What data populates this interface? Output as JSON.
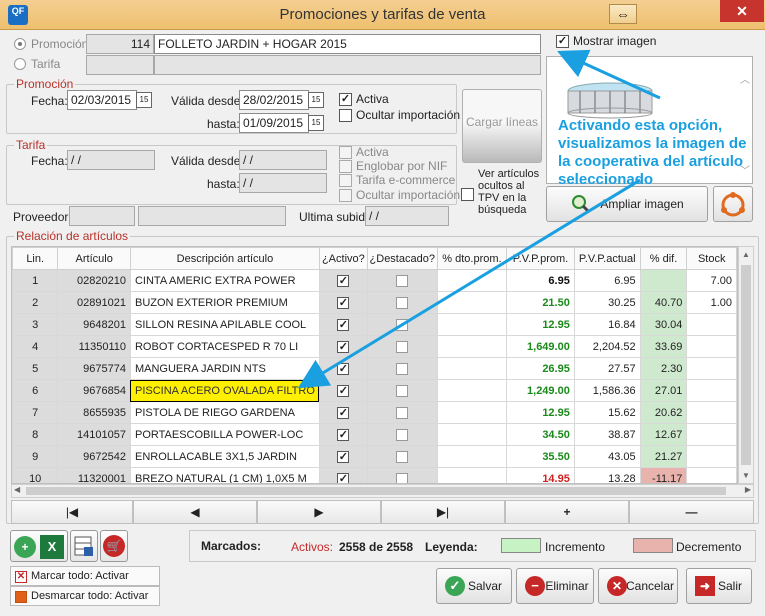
{
  "window": {
    "title": "Promociones y tarifas de venta",
    "logo_text": "QF"
  },
  "selector": {
    "promocion_label": "Promoción",
    "promocion_number": "114",
    "promocion_name": "FOLLETO JARDIN + HOGAR 2015",
    "tarifa_label": "Tarifa",
    "mostrar_imagen_label": "Mostrar imagen"
  },
  "promocion_group": {
    "title": "Promoción",
    "fecha_label": "Fecha:",
    "fecha": "02/03/2015",
    "valida_desde_label": "Válida desde:",
    "valida_desde": "28/02/2015",
    "hasta_label": "hasta:",
    "hasta": "01/09/2015",
    "activa_label": "Activa",
    "ocultar_label": "Ocultar importación"
  },
  "cargar_lineas_label": "Cargar líneas",
  "tarifa_group": {
    "title": "Tarifa",
    "fecha_label": "Fecha:",
    "fecha": " / /",
    "valida_desde_label": "Válida desde:",
    "valida_desde": " / /",
    "hasta_label": "hasta:",
    "hasta": " / /",
    "activa_label": "Activa",
    "englobar_label": "Englobar por NIF",
    "ecommerce_label": "Tarifa e-commerce",
    "ocultar_label": "Ocultar importación"
  },
  "ver_articulos_label": "Ver artículos ocultos al TPV en la búsqueda",
  "proveedor_label": "Proveedor:",
  "ultima_subida_label": "Ultima subida",
  "ultima_subida": " / /",
  "annotation_text": "Activando esta opción, visualizamos la imagen de la cooperativa del artículo seleccionado",
  "ampliar_imagen_label": "Ampliar imagen",
  "articles": {
    "title": "Relación de artículos",
    "headers": [
      "Lin.",
      "Artículo",
      "Descripción artículo",
      "¿Activo?",
      "¿Destacado?",
      "% dto.prom.",
      "P.V.P.prom.",
      "P.V.P.actual",
      "% dif.",
      "Stock"
    ],
    "rows": [
      {
        "lin": "1",
        "articulo": "02820210",
        "descripcion": "CINTA AMERIC EXTRA POWER",
        "activo": true,
        "destacado": false,
        "dto": "",
        "pvp_prom": "6.95",
        "prom_color": "#111111",
        "pvp_actual": "6.95",
        "dif": "",
        "dif_bg": "#cfe9cf",
        "stock": "7.00"
      },
      {
        "lin": "2",
        "articulo": "02891021",
        "descripcion": "BUZON EXTERIOR PREMIUM",
        "activo": true,
        "destacado": false,
        "dto": "",
        "pvp_prom": "21.50",
        "prom_color": "#1a8a1a",
        "pvp_actual": "30.25",
        "dif": "40.70",
        "dif_bg": "#cfe9cf",
        "stock": "1.00"
      },
      {
        "lin": "3",
        "articulo": "9648201",
        "descripcion": "SILLON RESINA APILABLE COOL",
        "activo": true,
        "destacado": false,
        "dto": "",
        "pvp_prom": "12.95",
        "prom_color": "#1a8a1a",
        "pvp_actual": "16.84",
        "dif": "30.04",
        "dif_bg": "#cfe9cf",
        "stock": ""
      },
      {
        "lin": "4",
        "articulo": "11350110",
        "descripcion": "ROBOT CORTACESPED R 70 LI",
        "activo": true,
        "destacado": false,
        "dto": "",
        "pvp_prom": "1,649.00",
        "prom_color": "#1a8a1a",
        "pvp_actual": "2,204.52",
        "dif": "33.69",
        "dif_bg": "#cfe9cf",
        "stock": ""
      },
      {
        "lin": "5",
        "articulo": "9675774",
        "descripcion": "MANGUERA JARDIN NTS",
        "activo": true,
        "destacado": false,
        "dto": "",
        "pvp_prom": "26.95",
        "prom_color": "#1a8a1a",
        "pvp_actual": "27.57",
        "dif": "2.30",
        "dif_bg": "#cfe9cf",
        "stock": ""
      },
      {
        "lin": "6",
        "articulo": "9676854",
        "descripcion": "PISCINA ACERO OVALADA FILTRO",
        "activo": true,
        "destacado": false,
        "dto": "",
        "pvp_prom": "1,249.00",
        "prom_color": "#1a8a1a",
        "pvp_actual": "1,586.36",
        "dif": "27.01",
        "dif_bg": "#cfe9cf",
        "stock": ""
      },
      {
        "lin": "7",
        "articulo": "8655935",
        "descripcion": "PISTOLA DE RIEGO GARDENA",
        "activo": true,
        "destacado": false,
        "dto": "",
        "pvp_prom": "12.95",
        "prom_color": "#1a8a1a",
        "pvp_actual": "15.62",
        "dif": "20.62",
        "dif_bg": "#cfe9cf",
        "stock": ""
      },
      {
        "lin": "8",
        "articulo": "14101057",
        "descripcion": "PORTAESCOBILLA POWER-LOC",
        "activo": true,
        "destacado": false,
        "dto": "",
        "pvp_prom": "34.50",
        "prom_color": "#1a8a1a",
        "pvp_actual": "38.87",
        "dif": "12.67",
        "dif_bg": "#cfe9cf",
        "stock": ""
      },
      {
        "lin": "9",
        "articulo": "9672542",
        "descripcion": "ENROLLACABLE 3X1,5 JARDIN",
        "activo": true,
        "destacado": false,
        "dto": "",
        "pvp_prom": "35.50",
        "prom_color": "#1a8a1a",
        "pvp_actual": "43.05",
        "dif": "21.27",
        "dif_bg": "#cfe9cf",
        "stock": ""
      },
      {
        "lin": "10",
        "articulo": "11320001",
        "descripcion": "BREZO NATURAL (1 CM) 1,0X5 M",
        "activo": true,
        "destacado": false,
        "dto": "",
        "pvp_prom": "14.95",
        "prom_color": "#d02020",
        "pvp_actual": "13.28",
        "dif": "-11.17",
        "dif_bg": "#e9b3ad",
        "stock": ""
      }
    ],
    "selected_row": 5
  },
  "nav": {
    "first": "|◀",
    "prev": "◀",
    "next": "▶",
    "last": "▶|",
    "add": "+",
    "remove": "—"
  },
  "footer": {
    "marcados_label": "Marcados:",
    "activos_label": "Activos:",
    "activos_value": "2558 de 2558",
    "leyenda_label": "Leyenda:",
    "incremento_label": "Incremento",
    "decremento_label": "Decremento",
    "incremento_color": "#c7f2c4",
    "decremento_color": "#e9b3ad",
    "marcar_todo": "Marcar todo:  Activar",
    "desmarcar_todo": "Desmarcar todo:  Activar",
    "salvar": "Salvar",
    "eliminar": "Eliminar",
    "cancelar": "Cancelar",
    "salir": "Salir"
  }
}
